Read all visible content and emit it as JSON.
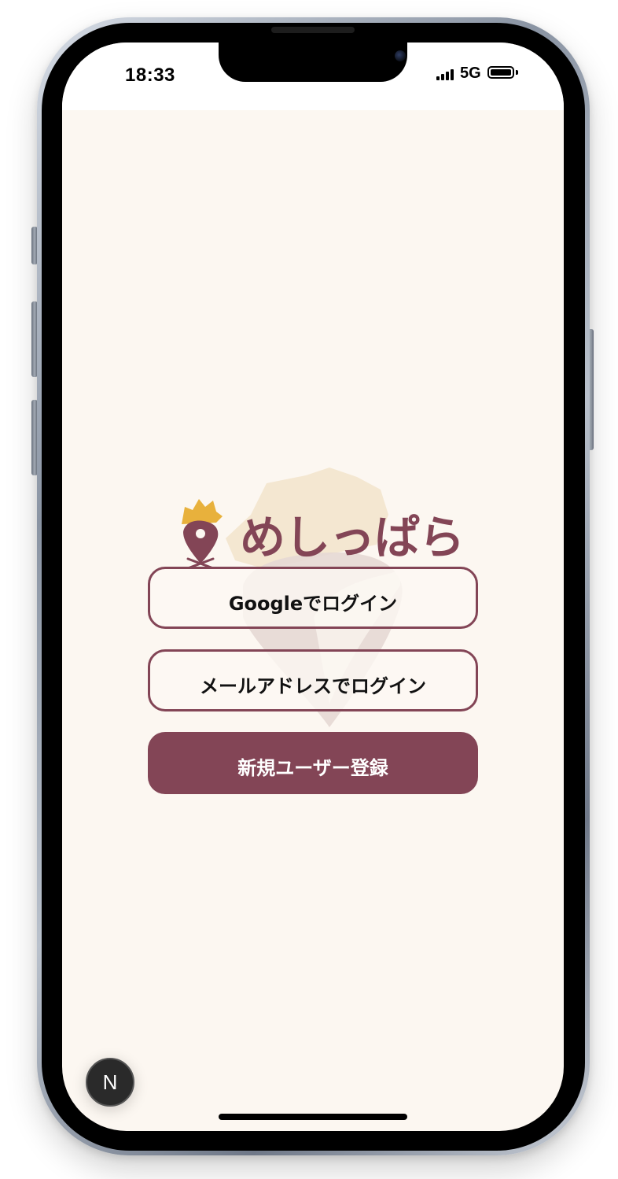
{
  "status_bar": {
    "time": "18:33",
    "network": "5G",
    "signal_icon": "signal-bars-icon",
    "battery_icon": "battery-full-icon"
  },
  "logo": {
    "text": "めしっぱら",
    "icon": "map-pin-logo-icon"
  },
  "auth": {
    "google_login": "Googleでログイン",
    "email_login": "メールアドレスでログイン",
    "register": "新規ユーザー登録"
  },
  "dev_badge": {
    "label": "N"
  },
  "colors": {
    "brand": "#834556",
    "background": "#fcf7f1",
    "accent_yellow": "#e8b13c"
  }
}
